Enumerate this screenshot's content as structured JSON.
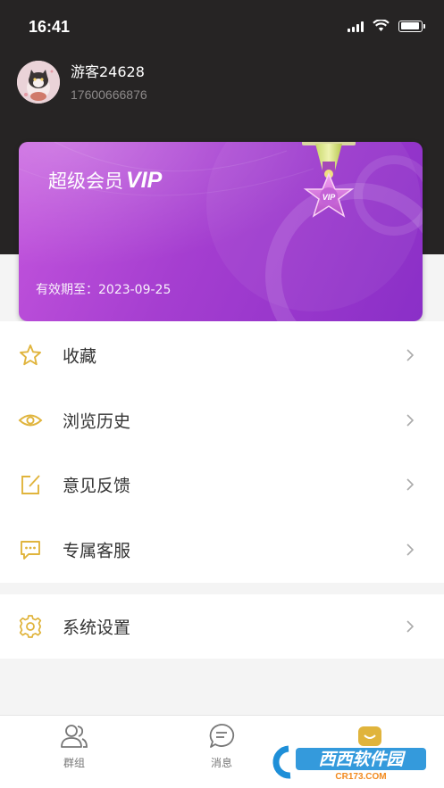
{
  "status": {
    "time": "16:41",
    "battery_level": 0.95
  },
  "user": {
    "name": "游客24628",
    "phone": "17600666876"
  },
  "vip": {
    "title": "超级会员",
    "vip_word": "VIP",
    "badge_text": "VIP",
    "expiry": "有效期至：2023-09-25"
  },
  "menu": [
    {
      "label": "收藏",
      "icon": "star-icon"
    },
    {
      "label": "浏览历史",
      "icon": "eye-icon"
    },
    {
      "label": "意见反馈",
      "icon": "edit-icon"
    },
    {
      "label": "专属客服",
      "icon": "chat-icon"
    }
  ],
  "settings": {
    "label": "系统设置",
    "icon": "gear-icon"
  },
  "tabs": [
    {
      "label": "群组",
      "icon": "group-icon"
    },
    {
      "label": "消息",
      "icon": "message-icon"
    }
  ],
  "watermark": {
    "text": "西西软件园",
    "url_text": "CR173.COM"
  },
  "colors": {
    "accent": "#e0b43c",
    "header": "#262424",
    "vip_start": "#c455dd",
    "vip_end": "#8a2fc7"
  }
}
